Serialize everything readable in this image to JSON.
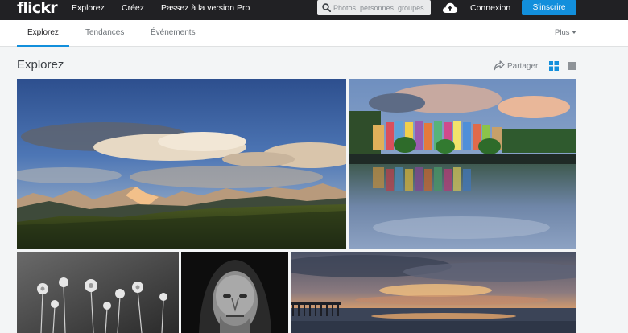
{
  "topbar": {
    "logo": "flickr",
    "nav": [
      "Explorez",
      "Créez",
      "Passez à la version Pro"
    ],
    "search_placeholder": "Photos, personnes, groupes",
    "login": "Connexion",
    "signup": "S'inscrire"
  },
  "subnav": {
    "tabs": [
      "Explorez",
      "Tendances",
      "Événements"
    ],
    "active_tab": "Explorez",
    "more": "Plus"
  },
  "main": {
    "title": "Explorez",
    "share_label": "Partager",
    "view_modes": [
      "grid",
      "single"
    ],
    "active_view": "grid"
  },
  "photos": [
    {
      "subject": "mountain landscape at sunset"
    },
    {
      "subject": "colorful waterfront houses reflected in water"
    },
    {
      "subject": "black and white wildflowers"
    },
    {
      "subject": "black and white portrait of an old man"
    },
    {
      "subject": "sunset over a pier on the sea"
    }
  ],
  "colors": {
    "topbar": "#212124",
    "accent": "#128fdc",
    "background": "#f3f5f6"
  }
}
